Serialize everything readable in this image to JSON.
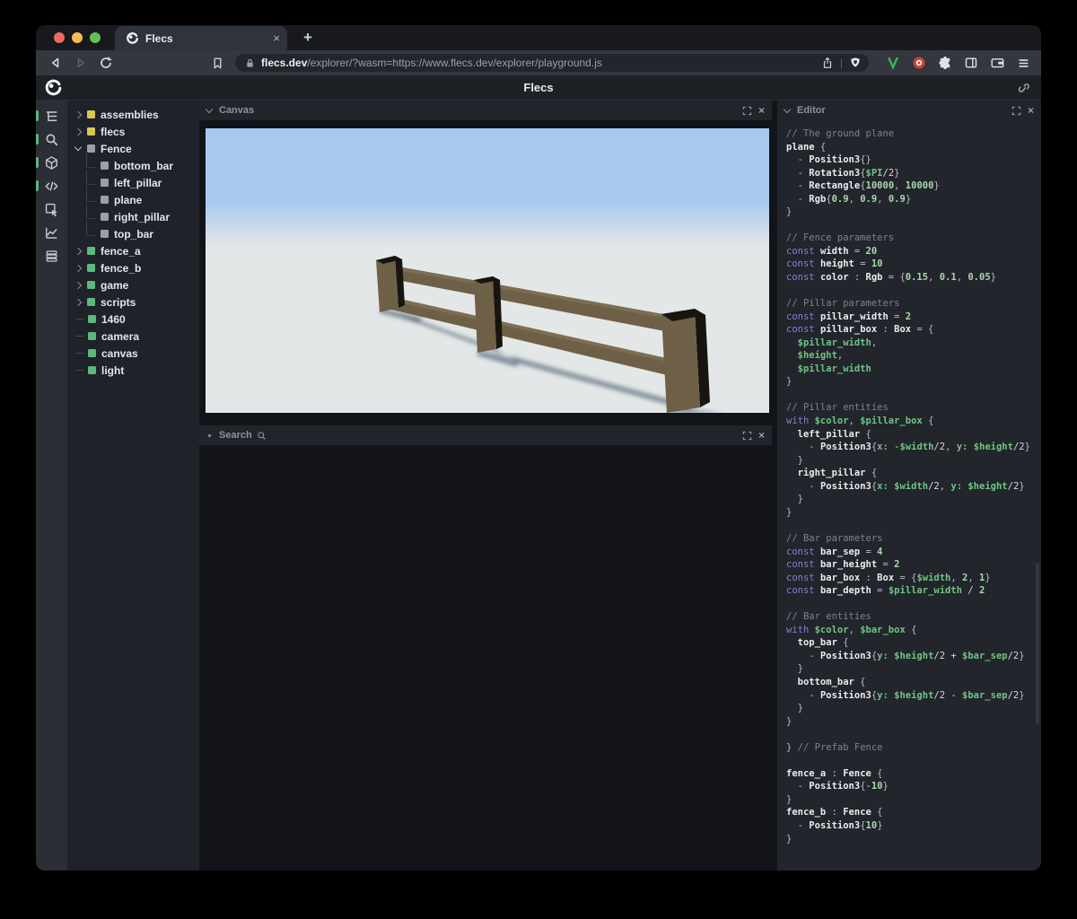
{
  "browser": {
    "tab": {
      "title": "Flecs",
      "close_glyph": "×"
    },
    "newtab_glyph": "+",
    "url": {
      "host": "flecs.dev",
      "path": "/explorer/?wasm=https://www.flecs.dev/explorer/playground.js"
    },
    "traffic_lights": {
      "red": "#ee6a5f",
      "yellow": "#f5bd4f",
      "green": "#61c354"
    }
  },
  "header": {
    "title": "Flecs"
  },
  "sidebar": {
    "icons": [
      {
        "name": "tree-icon",
        "active": true
      },
      {
        "name": "search-icon",
        "active": true
      },
      {
        "name": "cube-icon",
        "active": true
      },
      {
        "name": "code-icon",
        "active": true
      },
      {
        "name": "inspector-icon",
        "active": false
      },
      {
        "name": "chart-icon",
        "active": false
      },
      {
        "name": "stack-icon",
        "active": false
      }
    ]
  },
  "tree": {
    "items": [
      {
        "label": "assemblies",
        "color": "yellow",
        "kind": "collapsed"
      },
      {
        "label": "flecs",
        "color": "yellow",
        "kind": "collapsed"
      },
      {
        "label": "Fence",
        "color": "grey",
        "kind": "expanded"
      },
      {
        "label": "bottom_bar",
        "color": "grey",
        "kind": "child"
      },
      {
        "label": "left_pillar",
        "color": "grey",
        "kind": "child"
      },
      {
        "label": "plane",
        "color": "grey",
        "kind": "child"
      },
      {
        "label": "right_pillar",
        "color": "grey",
        "kind": "child"
      },
      {
        "label": "top_bar",
        "color": "grey",
        "kind": "child"
      },
      {
        "label": "fence_a",
        "color": "green",
        "kind": "collapsed"
      },
      {
        "label": "fence_b",
        "color": "green",
        "kind": "collapsed"
      },
      {
        "label": "game",
        "color": "green",
        "kind": "collapsed"
      },
      {
        "label": "scripts",
        "color": "green",
        "kind": "collapsed"
      },
      {
        "label": "1460",
        "color": "green",
        "kind": "leaf"
      },
      {
        "label": "camera",
        "color": "green",
        "kind": "leaf"
      },
      {
        "label": "canvas",
        "color": "green",
        "kind": "leaf"
      },
      {
        "label": "light",
        "color": "green",
        "kind": "leaf"
      }
    ]
  },
  "panels": {
    "canvas": {
      "title": "Canvas"
    },
    "search": {
      "title": "Search"
    },
    "editor": {
      "title": "Editor"
    },
    "close_glyph": "×"
  },
  "code": {
    "lines": [
      [
        [
          "cm",
          "// The ground plane"
        ]
      ],
      [
        [
          "id",
          "plane"
        ],
        [
          "pn",
          " {"
        ]
      ],
      [
        [
          "pn",
          "  - "
        ],
        [
          "id",
          "Position3"
        ],
        [
          "pn",
          "{}"
        ]
      ],
      [
        [
          "pn",
          "  - "
        ],
        [
          "id",
          "Rotation3"
        ],
        [
          "pn",
          "{"
        ],
        [
          "vr",
          "$PI"
        ],
        [
          "op",
          "/2"
        ],
        [
          "pn",
          "}"
        ]
      ],
      [
        [
          "pn",
          "  - "
        ],
        [
          "id",
          "Rectangle"
        ],
        [
          "pn",
          "{"
        ],
        [
          "nm",
          "10000"
        ],
        [
          "pn",
          ", "
        ],
        [
          "nm",
          "10000"
        ],
        [
          "pn",
          "}"
        ]
      ],
      [
        [
          "pn",
          "  - "
        ],
        [
          "id",
          "Rgb"
        ],
        [
          "pn",
          "{"
        ],
        [
          "nm",
          "0.9"
        ],
        [
          "pn",
          ", "
        ],
        [
          "nm",
          "0.9"
        ],
        [
          "pn",
          ", "
        ],
        [
          "nm",
          "0.9"
        ],
        [
          "pn",
          "}"
        ]
      ],
      [
        [
          "pn",
          "}"
        ]
      ],
      [],
      [
        [
          "cm",
          "// Fence parameters"
        ]
      ],
      [
        [
          "kw",
          "const "
        ],
        [
          "id",
          "width"
        ],
        [
          "pn",
          " = "
        ],
        [
          "nm",
          "20"
        ]
      ],
      [
        [
          "kw",
          "const "
        ],
        [
          "id",
          "height"
        ],
        [
          "pn",
          " = "
        ],
        [
          "nm",
          "10"
        ]
      ],
      [
        [
          "kw",
          "const "
        ],
        [
          "id",
          "color"
        ],
        [
          "pn",
          " : "
        ],
        [
          "id",
          "Rgb"
        ],
        [
          "pn",
          " = {"
        ],
        [
          "nm",
          "0.15"
        ],
        [
          "pn",
          ", "
        ],
        [
          "nm",
          "0.1"
        ],
        [
          "pn",
          ", "
        ],
        [
          "nm",
          "0.05"
        ],
        [
          "pn",
          "}"
        ]
      ],
      [],
      [
        [
          "cm",
          "// Pillar parameters"
        ]
      ],
      [
        [
          "kw",
          "const "
        ],
        [
          "id",
          "pillar_width"
        ],
        [
          "pn",
          " = "
        ],
        [
          "nm",
          "2"
        ]
      ],
      [
        [
          "kw",
          "const "
        ],
        [
          "id",
          "pillar_box"
        ],
        [
          "pn",
          " : "
        ],
        [
          "id",
          "Box"
        ],
        [
          "pn",
          " = {"
        ]
      ],
      [
        [
          "vr",
          "  $pillar_width"
        ],
        [
          "pn",
          ","
        ]
      ],
      [
        [
          "vr",
          "  $height"
        ],
        [
          "pn",
          ","
        ]
      ],
      [
        [
          "vr",
          "  $pillar_width"
        ]
      ],
      [
        [
          "pn",
          "}"
        ]
      ],
      [],
      [
        [
          "cm",
          "// Pillar entities"
        ]
      ],
      [
        [
          "kw",
          "with "
        ],
        [
          "vr",
          "$color"
        ],
        [
          "pn",
          ", "
        ],
        [
          "vr",
          "$pillar_box"
        ],
        [
          "pn",
          " {"
        ]
      ],
      [
        [
          "id",
          "  left_pillar"
        ],
        [
          "pn",
          " {"
        ]
      ],
      [
        [
          "pn",
          "    - "
        ],
        [
          "id",
          "Position3"
        ],
        [
          "pn",
          "{"
        ],
        [
          "vr",
          "x:"
        ],
        [
          "op",
          " -"
        ],
        [
          "vr",
          "$width"
        ],
        [
          "op",
          "/2"
        ],
        [
          "pn",
          ", "
        ],
        [
          "vr",
          "y: "
        ],
        [
          "vr",
          "$height"
        ],
        [
          "op",
          "/2"
        ],
        [
          "pn",
          "}"
        ]
      ],
      [
        [
          "pn",
          "  }"
        ]
      ],
      [
        [
          "id",
          "  right_pillar"
        ],
        [
          "pn",
          " {"
        ]
      ],
      [
        [
          "pn",
          "    - "
        ],
        [
          "id",
          "Position3"
        ],
        [
          "pn",
          "{"
        ],
        [
          "vr",
          "x: "
        ],
        [
          "vr",
          "$width"
        ],
        [
          "op",
          "/2"
        ],
        [
          "pn",
          ", "
        ],
        [
          "vr",
          "y: "
        ],
        [
          "vr",
          "$height"
        ],
        [
          "op",
          "/2"
        ],
        [
          "pn",
          "}"
        ]
      ],
      [
        [
          "pn",
          "  }"
        ]
      ],
      [
        [
          "pn",
          "}"
        ]
      ],
      [],
      [
        [
          "cm",
          "// Bar parameters"
        ]
      ],
      [
        [
          "kw",
          "const "
        ],
        [
          "id",
          "bar_sep"
        ],
        [
          "pn",
          " = "
        ],
        [
          "nm",
          "4"
        ]
      ],
      [
        [
          "kw",
          "const "
        ],
        [
          "id",
          "bar_height"
        ],
        [
          "pn",
          " = "
        ],
        [
          "nm",
          "2"
        ]
      ],
      [
        [
          "kw",
          "const "
        ],
        [
          "id",
          "bar_box"
        ],
        [
          "pn",
          " : "
        ],
        [
          "id",
          "Box"
        ],
        [
          "pn",
          " = {"
        ],
        [
          "vr",
          "$width"
        ],
        [
          "pn",
          ", "
        ],
        [
          "nm",
          "2"
        ],
        [
          "pn",
          ", "
        ],
        [
          "nm",
          "1"
        ],
        [
          "pn",
          "}"
        ]
      ],
      [
        [
          "kw",
          "const "
        ],
        [
          "id",
          "bar_depth"
        ],
        [
          "pn",
          " = "
        ],
        [
          "vr",
          "$pillar_width"
        ],
        [
          "op",
          " / "
        ],
        [
          "nm",
          "2"
        ]
      ],
      [],
      [
        [
          "cm",
          "// Bar entities"
        ]
      ],
      [
        [
          "kw",
          "with "
        ],
        [
          "vr",
          "$color"
        ],
        [
          "pn",
          ", "
        ],
        [
          "vr",
          "$bar_box"
        ],
        [
          "pn",
          " {"
        ]
      ],
      [
        [
          "id",
          "  top_bar"
        ],
        [
          "pn",
          " {"
        ]
      ],
      [
        [
          "pn",
          "    - "
        ],
        [
          "id",
          "Position3"
        ],
        [
          "pn",
          "{"
        ],
        [
          "vr",
          "y: "
        ],
        [
          "vr",
          "$height"
        ],
        [
          "op",
          "/2 + "
        ],
        [
          "vr",
          "$bar_sep"
        ],
        [
          "op",
          "/2"
        ],
        [
          "pn",
          "}"
        ]
      ],
      [
        [
          "pn",
          "  }"
        ]
      ],
      [
        [
          "id",
          "  bottom_bar"
        ],
        [
          "pn",
          " {"
        ]
      ],
      [
        [
          "pn",
          "    - "
        ],
        [
          "id",
          "Position3"
        ],
        [
          "pn",
          "{"
        ],
        [
          "vr",
          "y: "
        ],
        [
          "vr",
          "$height"
        ],
        [
          "op",
          "/2 - "
        ],
        [
          "vr",
          "$bar_sep"
        ],
        [
          "op",
          "/2"
        ],
        [
          "pn",
          "}"
        ]
      ],
      [
        [
          "pn",
          "  }"
        ]
      ],
      [
        [
          "pn",
          "}"
        ]
      ],
      [],
      [
        [
          "pn",
          "} "
        ],
        [
          "cm",
          "// Prefab Fence"
        ]
      ],
      [],
      [
        [
          "id",
          "fence_a"
        ],
        [
          "pn",
          " : "
        ],
        [
          "id",
          "Fence"
        ],
        [
          "pn",
          " {"
        ]
      ],
      [
        [
          "pn",
          "  - "
        ],
        [
          "id",
          "Position3"
        ],
        [
          "pn",
          "{"
        ],
        [
          "op",
          "-"
        ],
        [
          "nm",
          "10"
        ],
        [
          "pn",
          "}"
        ]
      ],
      [
        [
          "pn",
          "}"
        ]
      ],
      [
        [
          "id",
          "fence_b"
        ],
        [
          "pn",
          " : "
        ],
        [
          "id",
          "Fence"
        ],
        [
          "pn",
          " {"
        ]
      ],
      [
        [
          "pn",
          "  - "
        ],
        [
          "id",
          "Position3"
        ],
        [
          "pn",
          "{"
        ],
        [
          "nm",
          "10"
        ],
        [
          "pn",
          "}"
        ]
      ],
      [
        [
          "pn",
          "}"
        ]
      ]
    ]
  },
  "colors": {
    "accent_green": "#5cb87d",
    "square_yellow": "#d8c84f",
    "square_grey": "#9aa0a8",
    "c_cm": "#7d838d",
    "c_kw": "#7f83d2",
    "c_id": "#e9ebee",
    "c_pn": "#b6bcc6",
    "c_nm": "#a9d8ab",
    "c_vr": "#6fc584",
    "c_op": "#d4d8de",
    "sky": "#a8c9ee",
    "ground": "#e3e7e7",
    "wood": "#6e6046",
    "woodTop": "#7d6e52",
    "woodDark": "#17150f",
    "shadow": "#4e5f72"
  }
}
